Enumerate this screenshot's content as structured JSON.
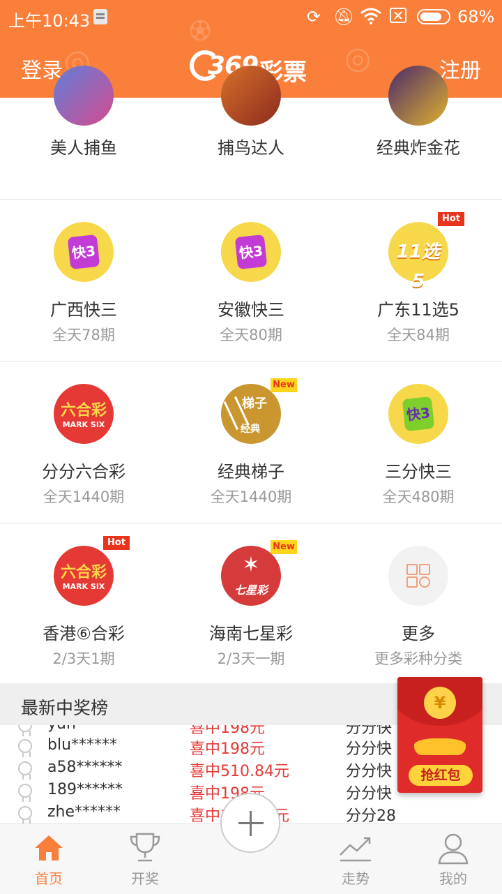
{
  "status": {
    "time": "上午10:43",
    "battery": "68%"
  },
  "header": {
    "login": "登录",
    "logo_num": "369",
    "logo_text": "彩票",
    "register": "注册"
  },
  "top_games": [
    {
      "name": "美人捕鱼"
    },
    {
      "name": "捕鸟达人"
    },
    {
      "name": "经典炸金花"
    }
  ],
  "lotteries": [
    {
      "name": "广西快三",
      "sub": "全天78期",
      "icon_text": "快3"
    },
    {
      "name": "安徽快三",
      "sub": "全天80期",
      "icon_text": "快3"
    },
    {
      "name": "广东11选5",
      "sub": "全天84期",
      "icon_text": "11选5",
      "badge": "Hot"
    },
    {
      "name": "分分六合彩",
      "sub": "全天1440期",
      "icon_text": "六合彩",
      "icon_sub": "MARK SIX"
    },
    {
      "name": "经典梯子",
      "sub": "全天1440期",
      "icon_text": "梯子",
      "icon_sub": "经典",
      "badge": "New"
    },
    {
      "name": "三分快三",
      "sub": "全天480期",
      "icon_text": "快3"
    },
    {
      "name": "香港⑥合彩",
      "sub": "2/3天1期",
      "icon_text": "六合彩",
      "icon_sub": "MARK SIX",
      "badge": "Hot"
    },
    {
      "name": "海南七星彩",
      "sub": "2/3天一期",
      "icon_text": "七星彩",
      "badge": "New"
    },
    {
      "name": "更多",
      "sub": "更多彩种分类"
    }
  ],
  "winners": {
    "title": "最新中奖榜",
    "rows": [
      {
        "user": "yun",
        "prize": "喜中198元",
        "game": "分分快"
      },
      {
        "user": "blu******",
        "prize": "喜中198元",
        "game": "分分快"
      },
      {
        "user": "a58******",
        "prize": "喜中510.84元",
        "game": "分分快"
      },
      {
        "user": "189******",
        "prize": "喜中198元",
        "game": "分分快"
      },
      {
        "user": "zhe******",
        "prize": "喜中1596.4元",
        "game": "分分28"
      }
    ]
  },
  "red_packet": {
    "coin": "¥",
    "label": "抢红包"
  },
  "nav": {
    "home": "首页",
    "draw": "开奖",
    "trend": "走势",
    "mine": "我的"
  },
  "colors": {
    "brand": "#f97f3b",
    "prize_red": "#e53935"
  }
}
